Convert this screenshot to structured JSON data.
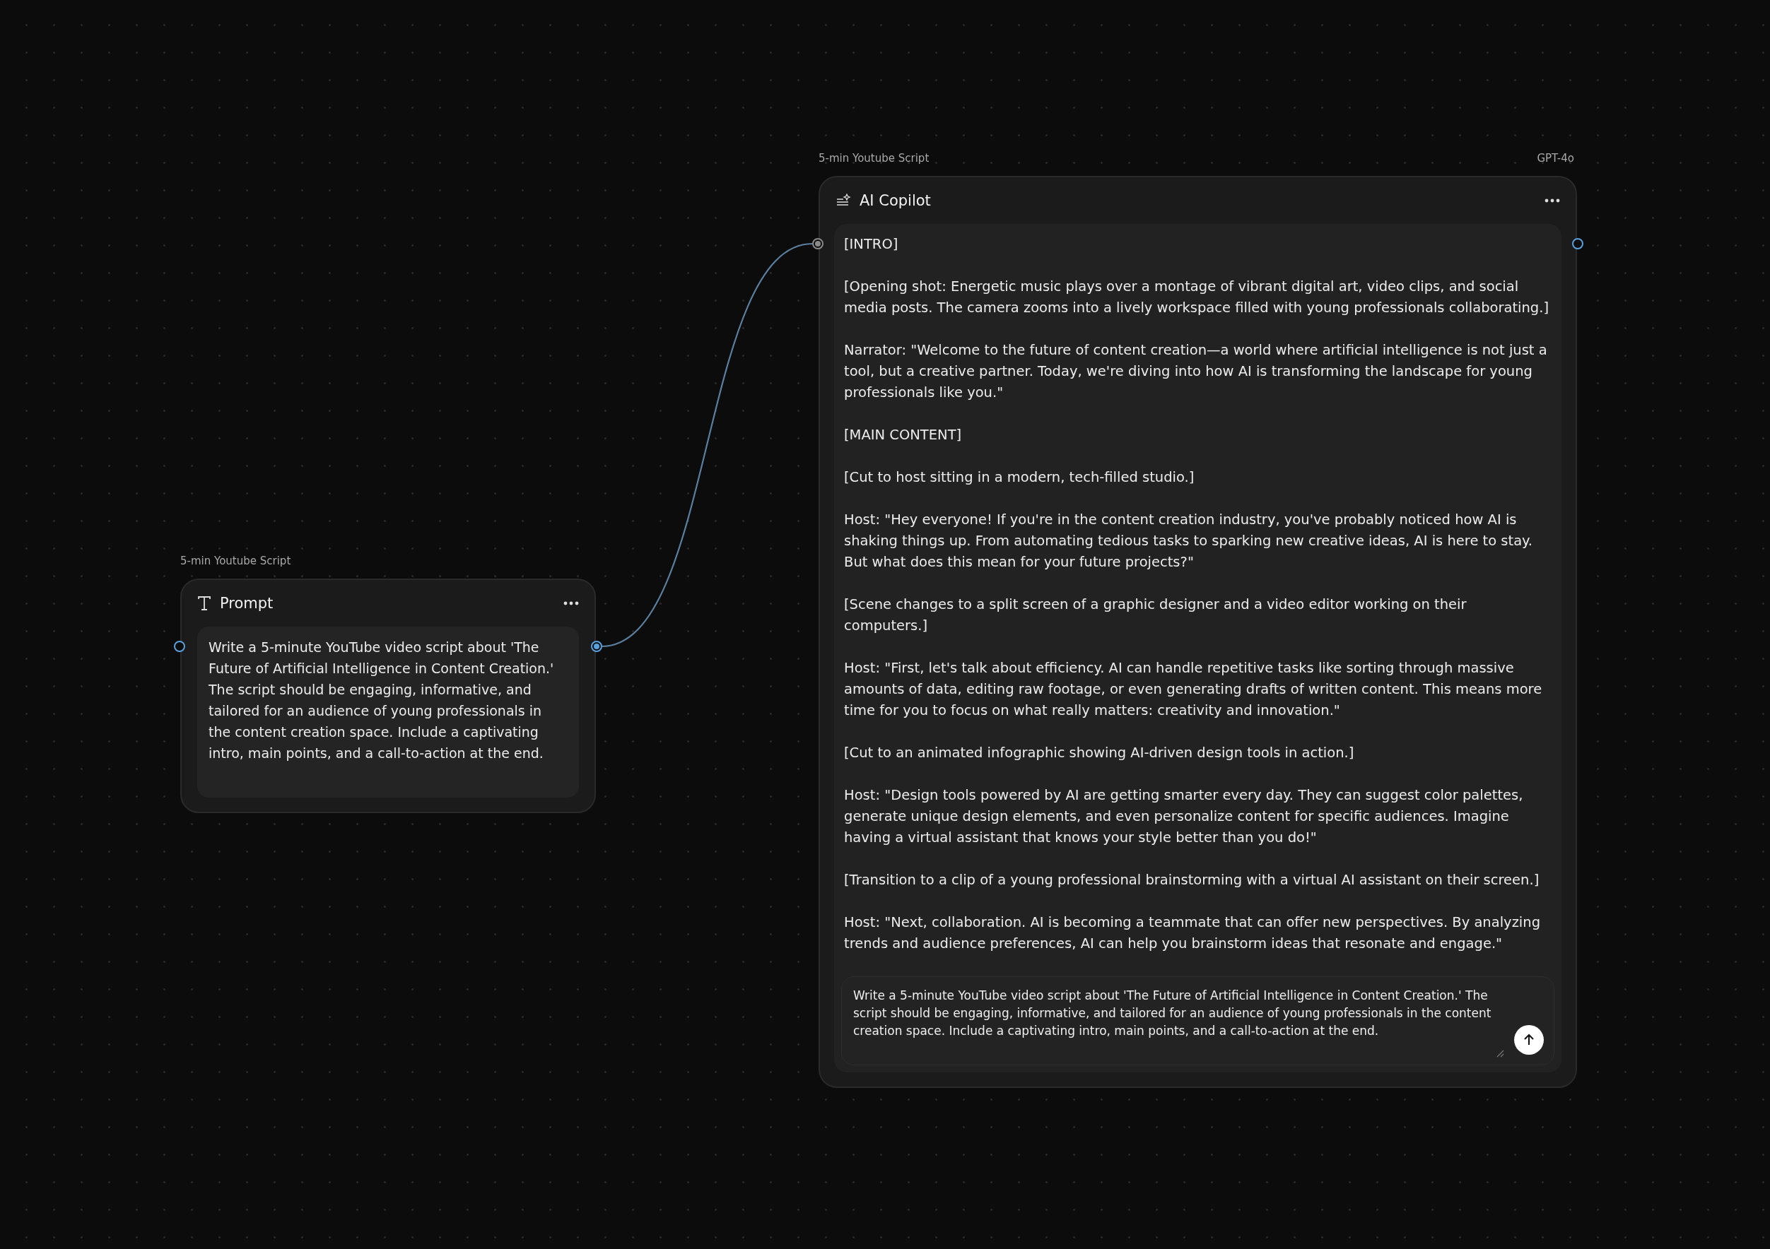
{
  "prompt_node": {
    "group_label": "5-min Youtube Script",
    "title": "Prompt",
    "text": "Write a 5-minute YouTube video script about 'The Future of Artificial Intelligence in Content Creation.' The script should be engaging, informative, and tailored for an audience of young professionals in the content creation space. Include a captivating intro, main points, and a call-to-action at the end.",
    "ports": [
      {
        "kind": "input",
        "connected": false
      },
      {
        "kind": "output",
        "connected": true
      }
    ]
  },
  "copilot_node": {
    "group_label": "5-min Youtube Script",
    "model": "GPT-4o",
    "title": "AI Copilot",
    "output": [
      "[INTRO]",
      "[Opening shot: Energetic music plays over a montage of vibrant digital art, video clips, and social media posts. The camera zooms into a lively workspace filled with young professionals collaborating.]",
      "Narrator: \"Welcome to the future of content creation—a world where artificial intelligence is not just a tool, but a creative partner. Today, we're diving into how AI is transforming the landscape for young professionals like you.\"",
      "[MAIN CONTENT]",
      "[Cut to host sitting in a modern, tech-filled studio.]",
      "Host: \"Hey everyone! If you're in the content creation industry, you've probably noticed how AI is shaking things up. From automating tedious tasks to sparking new creative ideas, AI is here to stay. But what does this mean for your future projects?\"",
      "[Scene changes to a split screen of a graphic designer and a video editor working on their computers.]",
      "Host: \"First, let's talk about efficiency. AI can handle repetitive tasks like sorting through massive amounts of data, editing raw footage, or even generating drafts of written content. This means more time for you to focus on what really matters: creativity and innovation.\"",
      "[Cut to an animated infographic showing AI-driven design tools in action.]",
      "Host: \"Design tools powered by AI are getting smarter every day. They can suggest color palettes, generate unique design elements, and even personalize content for specific audiences. Imagine having a virtual assistant that knows your style better than you do!\"",
      "[Transition to a clip of a young professional brainstorming with a virtual AI assistant on their screen.]",
      "Host: \"Next, collaboration. AI is becoming a teammate that can offer new perspectives. By analyzing trends and audience preferences, AI can help you brainstorm ideas that resonate and engage.\""
    ],
    "input": {
      "value": "Write a 5-minute YouTube video script about 'The Future of Artificial Intelligence in Content Creation.' The script should be engaging, informative, and tailored for an audience of young professionals in the content creation space. Include a captivating intro, main points, and a call-to-action at the end."
    },
    "ports": [
      {
        "kind": "input",
        "connected": true
      },
      {
        "kind": "output",
        "connected": false
      }
    ]
  }
}
